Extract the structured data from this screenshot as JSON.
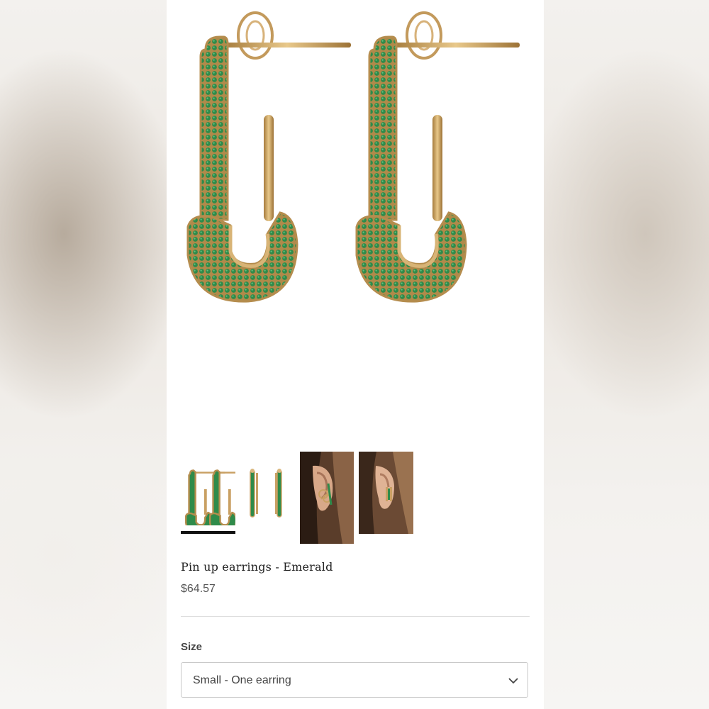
{
  "product": {
    "title": "Pin up earrings - Emerald",
    "price": "$64.57"
  },
  "gallery": {
    "thumbnails": [
      {
        "name": "front-view-pair"
      },
      {
        "name": "side-view-pair"
      },
      {
        "name": "worn-on-ear-1"
      },
      {
        "name": "worn-on-ear-2"
      }
    ],
    "selected_index": 0
  },
  "size": {
    "label": "Size",
    "selected": "Small - One earring",
    "icon": "chevron-down-icon"
  },
  "colors": {
    "gold": "#c9a063",
    "emerald": "#2f8b4a",
    "indicator": "#111111"
  }
}
